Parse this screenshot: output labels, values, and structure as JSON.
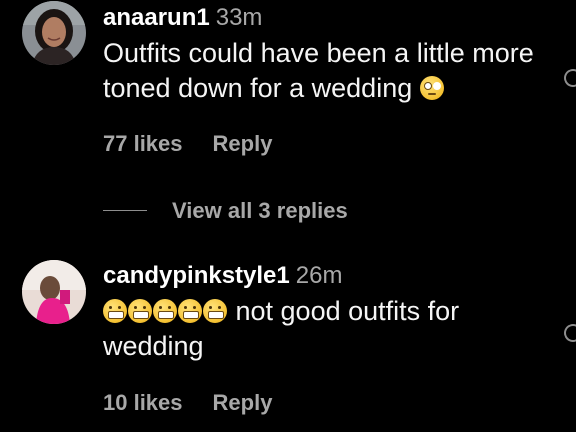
{
  "comments": [
    {
      "username": "anaarun1",
      "time": "33m",
      "text": "Outfits could have been a little more toned down for a wedding",
      "emoji": "face-with-rolling-eyes",
      "likes": "77 likes",
      "reply": "Reply"
    },
    {
      "username": "candypinkstyle1",
      "time": "26m",
      "text": " not good outfits for wedding",
      "emoji": "grimacing-face",
      "likes": "10 likes",
      "reply": "Reply"
    }
  ],
  "view_replies": {
    "label": "View all 3 replies"
  }
}
